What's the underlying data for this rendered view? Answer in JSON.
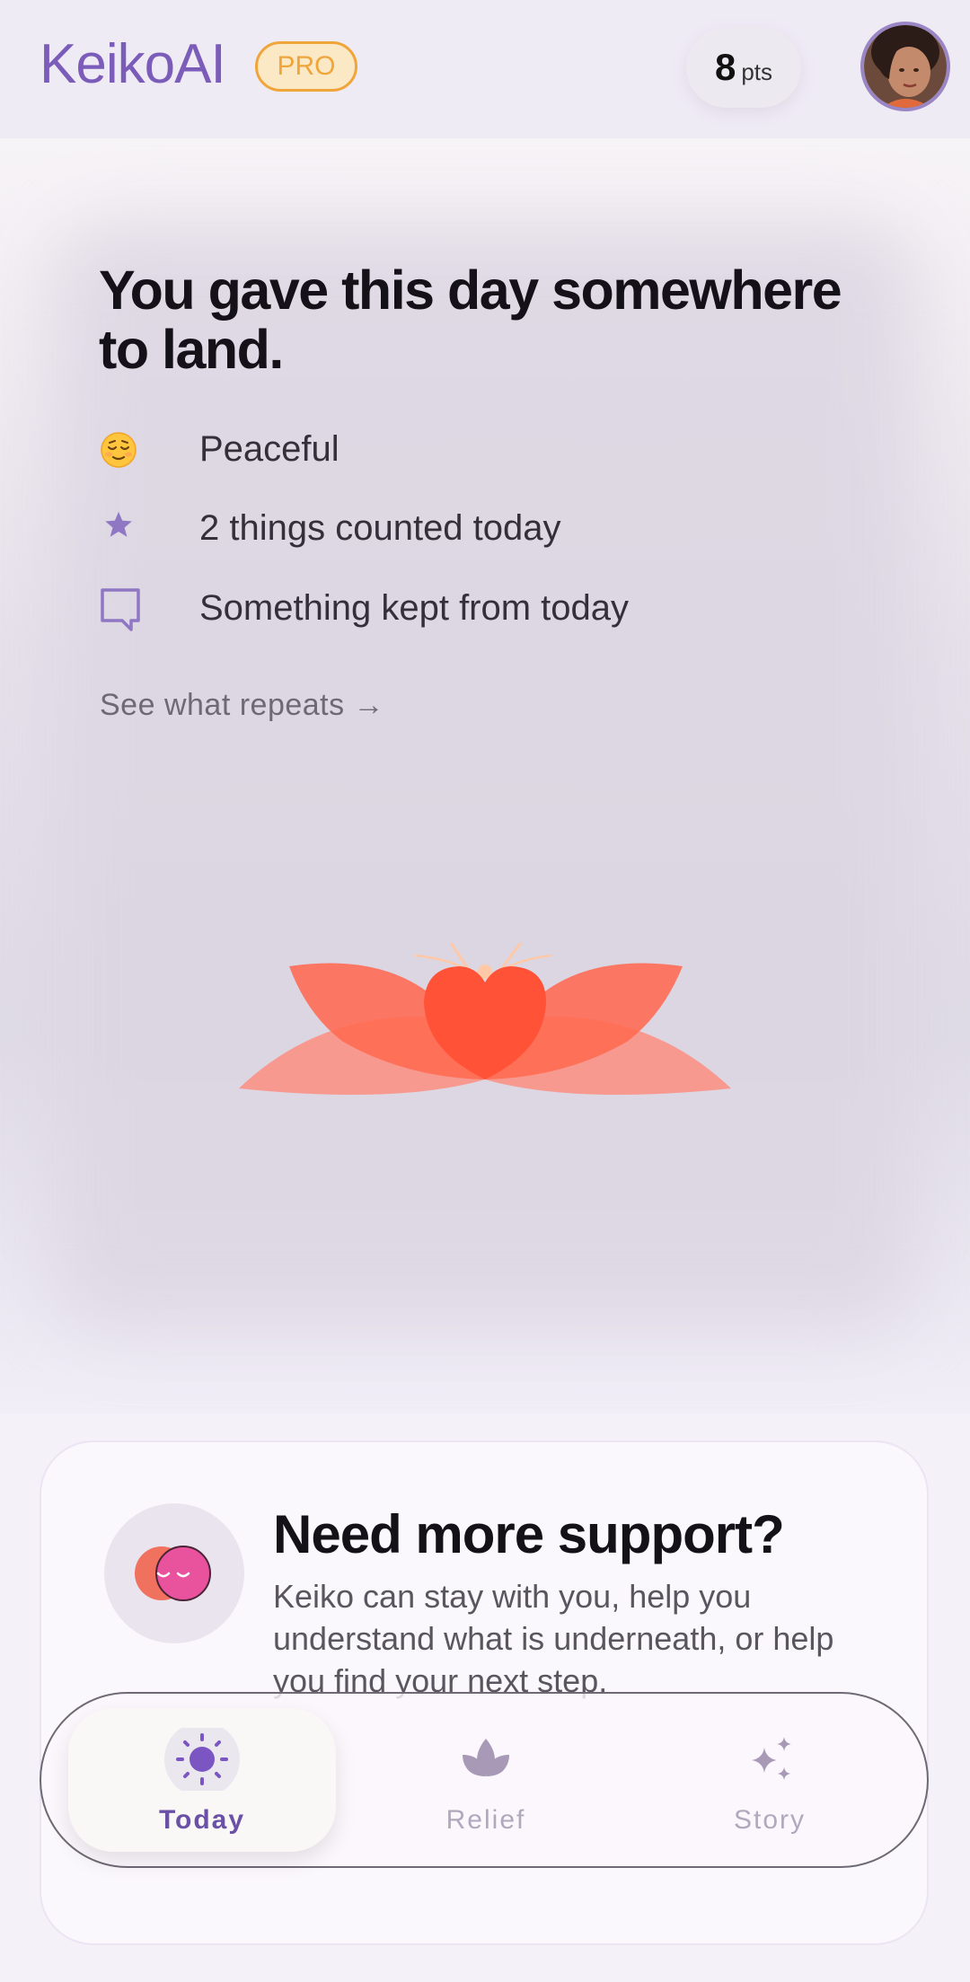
{
  "header": {
    "logo": "KeikoAI",
    "badge": "PRO",
    "points_value": "8",
    "points_unit": "pts"
  },
  "summary": {
    "headline": "You gave this day somewhere to land.",
    "items": [
      {
        "icon": "relieved-face-emoji",
        "text": "Peaceful"
      },
      {
        "icon": "star-icon",
        "text": "2 things counted today"
      },
      {
        "icon": "speech-bubble-icon",
        "text": "Something kept from today"
      }
    ],
    "link": "See what repeats →"
  },
  "support": {
    "title": "Need more support?",
    "body": "Keiko can stay with you, help you understand what is underneath, or help you find your next step."
  },
  "nav": {
    "tabs": [
      {
        "label": "Today",
        "icon": "sun-icon",
        "active": true
      },
      {
        "label": "Relief",
        "icon": "lotus-icon",
        "active": false
      },
      {
        "label": "Story",
        "icon": "sparkles-icon",
        "active": false
      }
    ]
  },
  "colors": {
    "brand": "#7b5cb8",
    "pro_badge": "#f0a53a",
    "lotus": "#ff5a3c"
  }
}
